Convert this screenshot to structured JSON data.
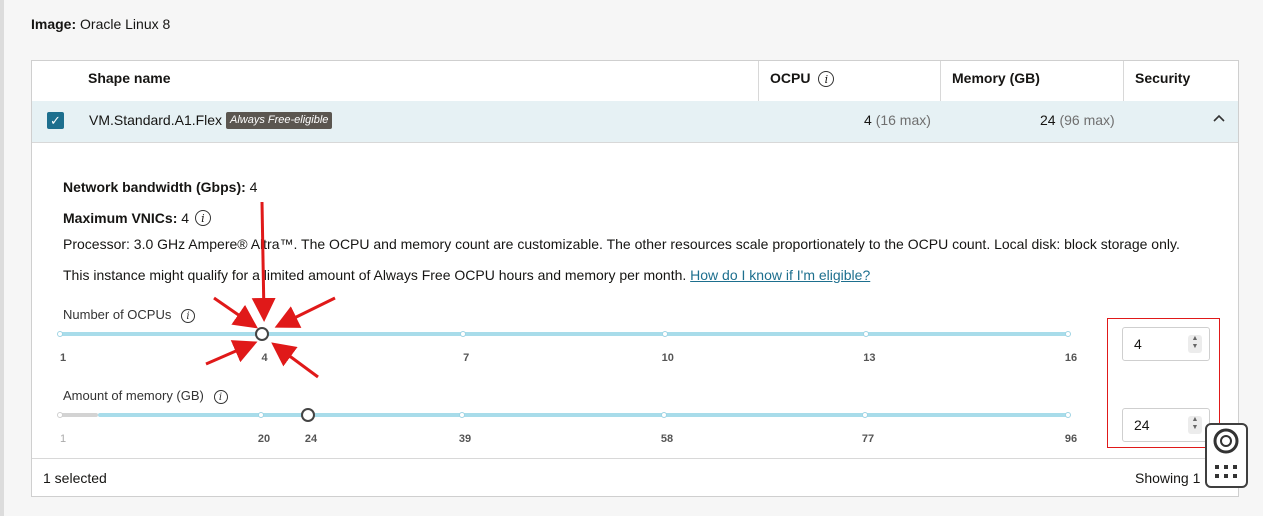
{
  "image": {
    "label": "Image:",
    "value": "Oracle Linux 8"
  },
  "table": {
    "columns": {
      "shape_name": "Shape name",
      "ocpu": "OCPU",
      "memory": "Memory (GB)",
      "security": "Security"
    },
    "row": {
      "name": "VM.Standard.A1.Flex",
      "badge": "Always Free-eligible",
      "ocpu_value": "4",
      "ocpu_max": "(16 max)",
      "memory_value": "24",
      "memory_max": "(96 max)"
    }
  },
  "details": {
    "bandwidth_label": "Network bandwidth (Gbps):",
    "bandwidth_value": "4",
    "vnics_label": "Maximum VNICs:",
    "vnics_value": "4",
    "processor_text": "Processor: 3.0 GHz Ampere® Altra™. The OCPU and memory count are customizable. The other resources scale proportionately to the OCPU count. Local disk: block storage only.",
    "free_text": "This instance might qualify for a limited amount of Always Free OCPU hours and memory per month.",
    "free_link": "How do I know if I'm eligible?"
  },
  "ocpu_slider": {
    "label": "Number of OCPUs",
    "ticks": [
      "1",
      "4",
      "7",
      "10",
      "13",
      "16"
    ],
    "value": 4,
    "min": 1,
    "max": 16,
    "input_value": "4"
  },
  "memory_slider": {
    "label": "Amount of memory (GB)",
    "ticks": [
      "1",
      "20",
      "24",
      "39",
      "58",
      "77",
      "96"
    ],
    "value": 24,
    "min": 1,
    "max": 96,
    "input_value": "24"
  },
  "footer": {
    "selected": "1 selected",
    "showing": "Showing 1"
  },
  "colors": {
    "accent": "#1d6f8e",
    "row_highlight": "#e6f1f4",
    "annotation": "#e01919",
    "slider_track": "#a8dcea"
  }
}
